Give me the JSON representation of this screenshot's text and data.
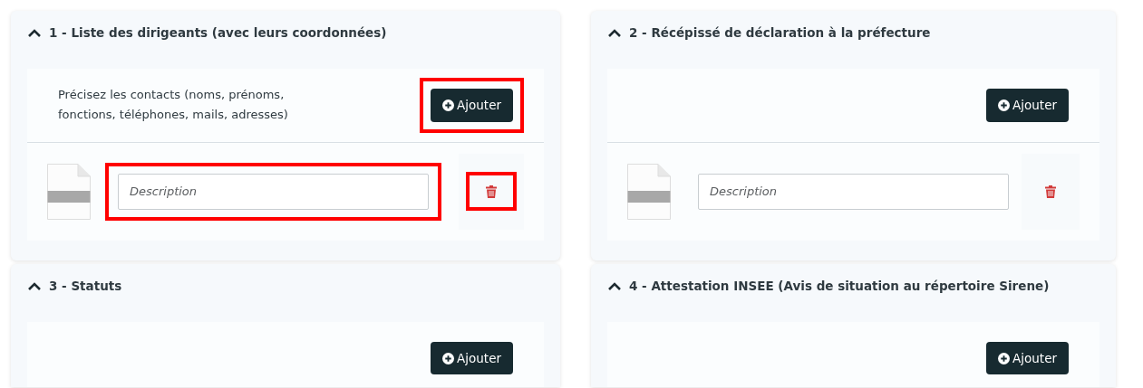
{
  "sections": [
    {
      "title": "1 - Liste des dirigeants (avec leurs coordonnées)",
      "expanded": true,
      "hint": "Précisez les contacts (noms, prénoms, fonctions, téléphones, mails, adresses)",
      "add_button": {
        "label": "Ajouter",
        "highlighted": true
      },
      "files": [
        {
          "placeholder": "Description",
          "field_highlighted": true,
          "delete_highlighted": true
        }
      ]
    },
    {
      "title": "2 - Récépissé de déclaration à la préfecture",
      "expanded": true,
      "add_button": {
        "label": "Ajouter",
        "highlighted": false
      },
      "files": [
        {
          "placeholder": "Description",
          "field_highlighted": false,
          "delete_highlighted": false
        }
      ]
    },
    {
      "title": "3 - Statuts",
      "expanded": true,
      "add_button": {
        "label": "Ajouter",
        "highlighted": false
      }
    },
    {
      "title": "4 - Attestation INSEE (Avis de situation au répertoire Sirene)",
      "expanded": true,
      "add_button": {
        "label": "Ajouter",
        "highlighted": false
      }
    }
  ]
}
